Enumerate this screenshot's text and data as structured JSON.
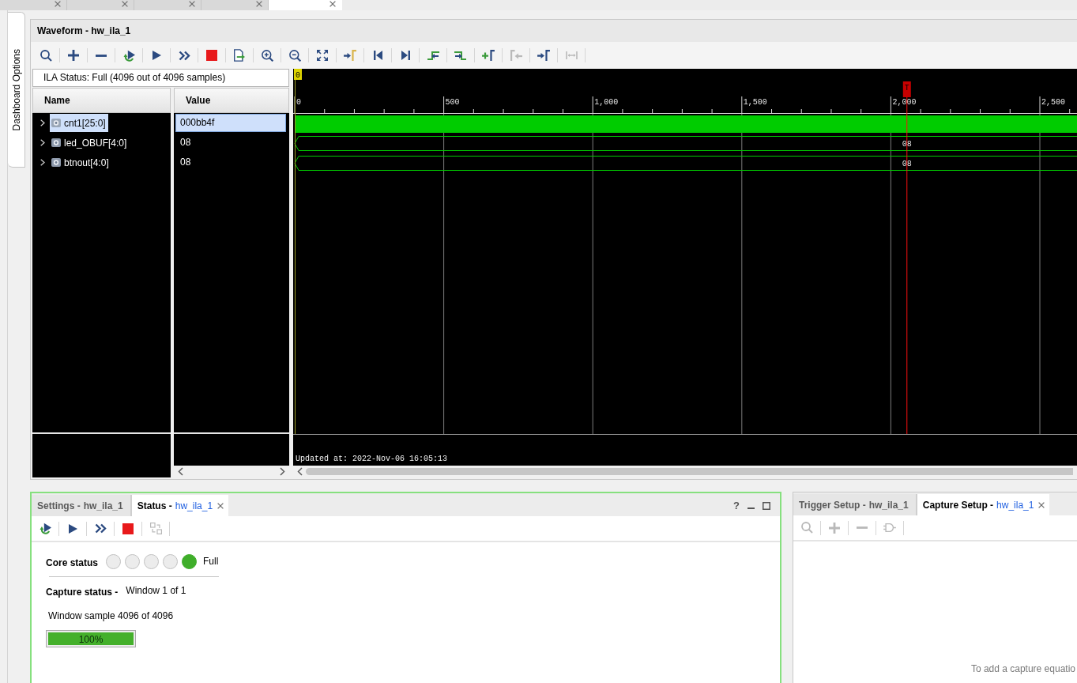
{
  "document_tabs": [
    {
      "selected": false
    },
    {
      "selected": false
    },
    {
      "selected": false
    },
    {
      "selected": false
    },
    {
      "selected": true
    }
  ],
  "side_tab": {
    "label": "Dashboard Options"
  },
  "waveform": {
    "title": "Waveform - hw_ila_1",
    "toolbar": [
      {
        "kind": "search",
        "disabled": false
      },
      {
        "kind": "add",
        "disabled": false
      },
      {
        "kind": "remove",
        "disabled": false
      },
      {
        "kind": "run_trigger",
        "disabled": false
      },
      {
        "kind": "run",
        "disabled": false
      },
      {
        "kind": "run_immediate",
        "disabled": false
      },
      {
        "kind": "stop",
        "disabled": false
      },
      {
        "kind": "export",
        "disabled": false
      },
      {
        "kind": "zoom_in",
        "disabled": false
      },
      {
        "kind": "zoom_out",
        "disabled": false
      },
      {
        "kind": "zoom_fit",
        "disabled": false
      },
      {
        "kind": "go_to_cursor",
        "disabled": false
      },
      {
        "kind": "go_to_start",
        "disabled": false
      },
      {
        "kind": "go_to_end",
        "disabled": false
      },
      {
        "kind": "previous_transition",
        "disabled": false
      },
      {
        "kind": "next_transition",
        "disabled": false
      },
      {
        "kind": "add_marker",
        "disabled": false
      },
      {
        "kind": "previous_marker",
        "disabled": true
      },
      {
        "kind": "next_marker",
        "disabled": false
      },
      {
        "kind": "swap_cursors",
        "disabled": true
      }
    ],
    "ila_status": "ILA Status: Full (4096 out of 4096 samples)",
    "columns": [
      "Name",
      "Value"
    ],
    "signals": [
      {
        "name": "cnt1[25:0]",
        "value": "000bb4f",
        "expanded": false,
        "selected": true,
        "kind": "dense"
      },
      {
        "name": "led_OBUF[4:0]",
        "value": "08",
        "expanded": false,
        "selected": false,
        "kind": "bus",
        "trace_label": "08"
      },
      {
        "name": "btnout[4:0]",
        "value": "08",
        "expanded": false,
        "selected": false,
        "kind": "bus",
        "trace_label": "08"
      }
    ],
    "markers": [
      {
        "kind": "origin",
        "label": "0"
      },
      {
        "kind": "trigger",
        "label": "T"
      }
    ],
    "time_ticks": [
      "0",
      "500",
      "1,000",
      "1,500",
      "2,000",
      "2,500"
    ],
    "updated": "Updated at: 2022-Nov-06 16:05:13"
  },
  "status_panel": {
    "tabs": [
      {
        "label": "Settings -",
        "target": "hw_ila_1",
        "selected": false
      },
      {
        "label": "Status -",
        "target": "hw_ila_1",
        "selected": true
      }
    ],
    "help": "?",
    "toolbar": [
      {
        "kind": "run_trigger",
        "disabled": false
      },
      {
        "kind": "run",
        "disabled": false
      },
      {
        "kind": "run_immediate",
        "disabled": false
      },
      {
        "kind": "stop",
        "disabled": false
      },
      {
        "kind": "switch",
        "disabled": true
      }
    ],
    "core_status": {
      "label": "Core status",
      "lights": [
        {
          "on": false
        },
        {
          "on": false
        },
        {
          "on": false
        },
        {
          "on": false
        },
        {
          "on": true
        }
      ],
      "text": "Full"
    },
    "capture_status": {
      "label": "Capture status -",
      "text": "Window 1 of 1"
    },
    "window_sample": "Window sample 4096 of 4096",
    "progress": {
      "level": 1,
      "text": "100%"
    }
  },
  "capture_panel": {
    "tabs": [
      {
        "label": "Trigger Setup -",
        "target": "hw_ila_1",
        "selected": false
      },
      {
        "label": "Capture Setup -",
        "target": "hw_ila_1",
        "selected": true
      }
    ],
    "toolbar": [
      {
        "kind": "search",
        "disabled": true
      },
      {
        "kind": "add",
        "disabled": true
      },
      {
        "kind": "remove",
        "disabled": true
      },
      {
        "kind": "gate",
        "disabled": true
      }
    ],
    "hint": "To add a capture equatio"
  }
}
